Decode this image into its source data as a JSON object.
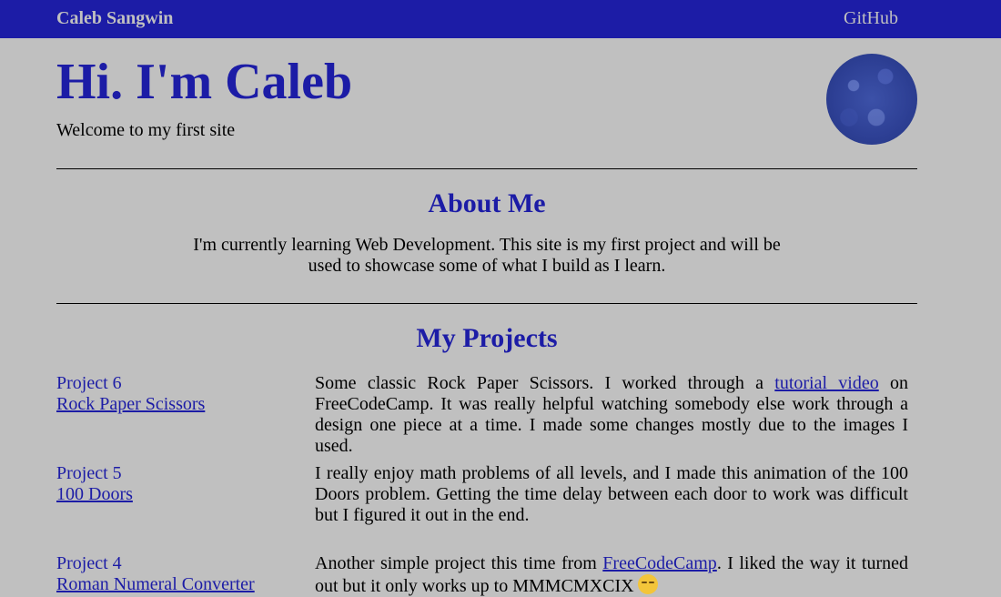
{
  "nav": {
    "brand": "Caleb Sangwin",
    "github": "GitHub"
  },
  "hero": {
    "title": "Hi. I'm Caleb",
    "subtitle": "Welcome to my first site"
  },
  "about": {
    "title": "About Me",
    "text": "I'm currently learning Web Development. This site is my first project and will be used to showcase some of what I build as I learn."
  },
  "projects": {
    "title": "My Projects",
    "items": [
      {
        "number": "Project 6",
        "name": "Rock Paper Scissors",
        "desc_before": "Some classic Rock Paper Scissors. I worked through a ",
        "desc_link": "tutorial video",
        "desc_after": " on FreeCodeCamp. It was really helpful watching somebody else work through a design one piece at a time. I made some changes mostly due to the images I used."
      },
      {
        "number": "Project 5",
        "name": "100 Doors",
        "desc": "I really enjoy math problems of all levels, and I made this animation of the 100 Doors problem. Getting the time delay between each door to work was difficult but I figured it out in the end."
      },
      {
        "number": "Project 4",
        "name": "Roman Numeral Converter",
        "desc_before": "Another simple project this time from ",
        "desc_link": "FreeCodeCamp",
        "desc_after": ". I liked the way it turned out but it only works up to MMMCMXCIX",
        "emoji": "smirk-emoji"
      }
    ]
  },
  "colors": {
    "background": "#c0c0c0",
    "accent": "#1c1ca6",
    "nav_text": "#c0c0c0"
  }
}
